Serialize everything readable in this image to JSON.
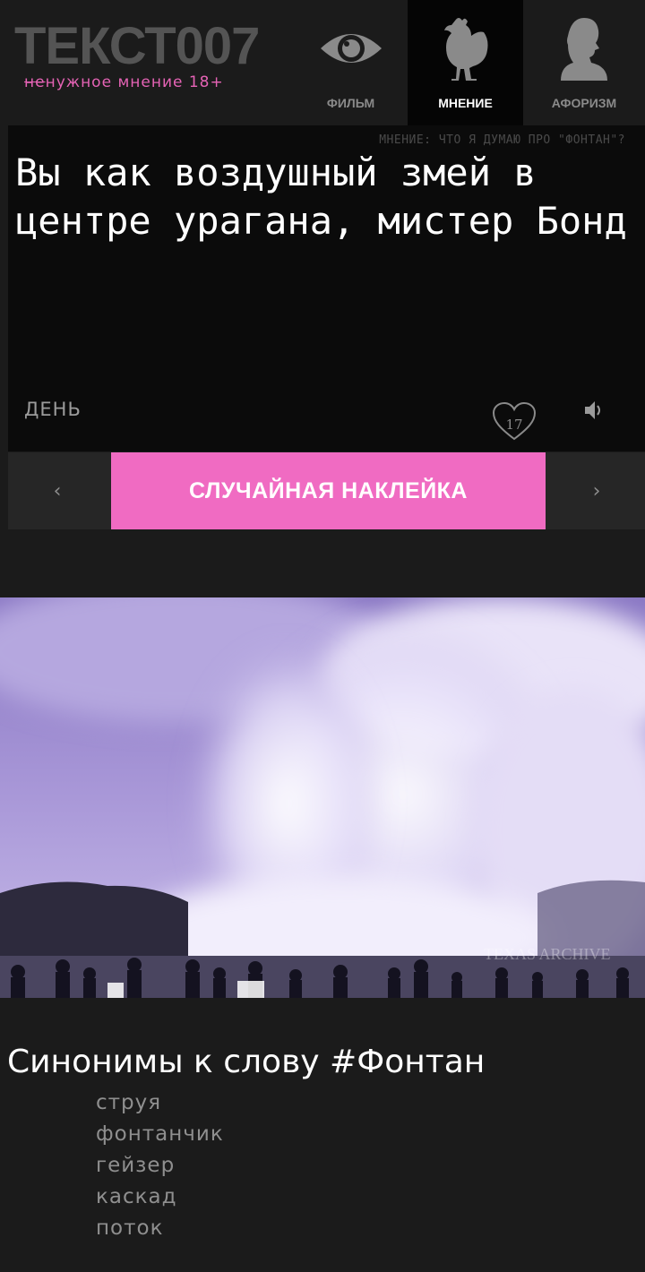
{
  "header": {
    "logo": "ТЕКСТ007",
    "tagline_strike": "не",
    "tagline_rest": "нужное мнение 18+",
    "nav": [
      {
        "label": "ФИЛЬМ",
        "icon": "eye-icon"
      },
      {
        "label": "МНЕНИЕ",
        "icon": "chicken-icon"
      },
      {
        "label": "АФОРИЗМ",
        "icon": "profile-bust-icon"
      }
    ]
  },
  "card": {
    "caption": "МНЕНИЕ: ЧТО Я ДУМАЮ ПРО \"ФОНТАН\"?",
    "quote": "Вы как воздушный змей в центре урагана, мистер Бонд",
    "day_label": "ДЕНЬ",
    "likes": "17",
    "like_icon": "heart-icon",
    "sound_icon": "speaker-icon"
  },
  "navigation": {
    "prev": "‹",
    "next": "›",
    "random_button": "СЛУЧАЙНАЯ НАКЛЕЙКА"
  },
  "photo": {
    "watermark": "TEXAS ARCHIVE"
  },
  "synonyms": {
    "title": "Синонимы к слову #Фонтан",
    "items": [
      "струя",
      "фонтанчик",
      "гейзер",
      "каскад",
      "поток"
    ]
  },
  "colors": {
    "accent": "#f06bc2",
    "tagline": "#e563b5",
    "background": "#1b1b1b",
    "card": "#0b0b0b"
  }
}
